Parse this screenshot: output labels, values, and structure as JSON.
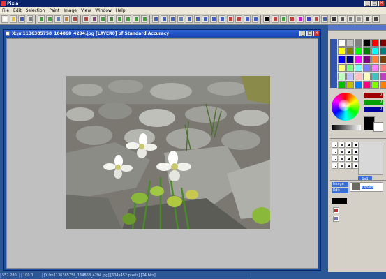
{
  "app": {
    "title": "Pixia",
    "menu": [
      "File",
      "Edit",
      "Selection",
      "Paint",
      "Image",
      "View",
      "Window",
      "Help"
    ]
  },
  "toolbar": {
    "tools": [
      {
        "icon": "new-file-icon",
        "color": "#ffffff"
      },
      {
        "icon": "open-folder-icon",
        "color": "#e8c040"
      },
      {
        "icon": "save-icon",
        "color": "#4060c0"
      },
      {
        "icon": "print-icon",
        "color": "#808080"
      },
      {
        "icon": "undo-icon",
        "color": "#40a040"
      },
      {
        "icon": "redo-icon",
        "color": "#40a040"
      },
      {
        "icon": "copy-icon",
        "color": "#6080c0"
      },
      {
        "icon": "paste-icon",
        "color": "#c08040"
      },
      {
        "icon": "delete-icon",
        "color": "#c04040"
      },
      {
        "icon": "pen-icon",
        "color": "#c04040"
      },
      {
        "icon": "brush-icon",
        "color": "#804080"
      },
      {
        "icon": "rectangle-icon",
        "color": "#40a040"
      },
      {
        "icon": "line-icon",
        "color": "#408040"
      },
      {
        "icon": "circle-icon",
        "color": "#40a040"
      },
      {
        "icon": "lasso-icon",
        "color": "#40a040"
      },
      {
        "icon": "curve-icon",
        "color": "#40a040"
      },
      {
        "icon": "polygon-icon",
        "color": "#40a040"
      },
      {
        "icon": "magic-wand-icon",
        "color": "#4060c0"
      },
      {
        "icon": "select-icon",
        "color": "#4060c0"
      },
      {
        "icon": "fill-icon",
        "color": "#4060c0"
      },
      {
        "icon": "gradient-icon",
        "color": "#6080c0"
      },
      {
        "icon": "eyedropper-icon",
        "color": "#4060c0"
      },
      {
        "icon": "text-icon",
        "color": "#4060c0"
      },
      {
        "icon": "hand-icon",
        "color": "#4060c0"
      },
      {
        "icon": "zoom-icon",
        "color": "#4060c0"
      },
      {
        "icon": "rotate-icon",
        "color": "#4060c0"
      },
      {
        "icon": "stamp-icon",
        "color": "#c04040"
      },
      {
        "icon": "smudge-icon",
        "color": "#c04040"
      },
      {
        "icon": "blur-icon",
        "color": "#4060c0"
      },
      {
        "icon": "sharpen-icon",
        "color": "#4060c0"
      },
      {
        "icon": "foreground-color-icon",
        "color": "#000000"
      },
      {
        "icon": "filter-icon",
        "color": "#c04040"
      },
      {
        "icon": "image-icon",
        "color": "#40a040"
      },
      {
        "icon": "layer-icon",
        "color": "#c04040"
      },
      {
        "icon": "color-balance-icon",
        "color": "#c020c0"
      },
      {
        "icon": "channel-icon",
        "color": "#4040c0"
      },
      {
        "icon": "mask-icon",
        "color": "#c04040"
      },
      {
        "icon": "help-icon",
        "color": "#4060c0"
      }
    ]
  },
  "document": {
    "title": "X:\\m1136385758_164868_4294.jpg [LAYER0] of Standard Accuracy"
  },
  "status": {
    "coords": "552 280",
    "zoom": "100.0",
    "file": "[X:\\m1136385758_164868_4294.jpg] [604x452 pixels] [24 bits]"
  },
  "color_panel": {
    "r": "0",
    "g": "0",
    "b": "0",
    "palette": [
      "#ffffff",
      "#c0c0c0",
      "#808080",
      "#000000",
      "#ff0000",
      "#800000",
      "#ffff00",
      "#808000",
      "#00ff00",
      "#008000",
      "#00ffff",
      "#008080",
      "#0000ff",
      "#000080",
      "#ff00ff",
      "#800080",
      "#ff8040",
      "#804000",
      "#ffff80",
      "#80ff80",
      "#80ffff",
      "#8080ff",
      "#ff80ff",
      "#ff8080",
      "#c0ffc0",
      "#c0c0ff",
      "#ffc0c0",
      "#ffffc0",
      "#40c0c0",
      "#c040c0",
      "#00c000",
      "#c0c000",
      "#0080ff",
      "#ff0080",
      "#80ff00",
      "#ff8000"
    ]
  },
  "brushes": {
    "size_label": "1x1"
  },
  "layers": {
    "image_tab": "Image",
    "edit_tab": "Edit",
    "layer_name": "LAYER0"
  }
}
